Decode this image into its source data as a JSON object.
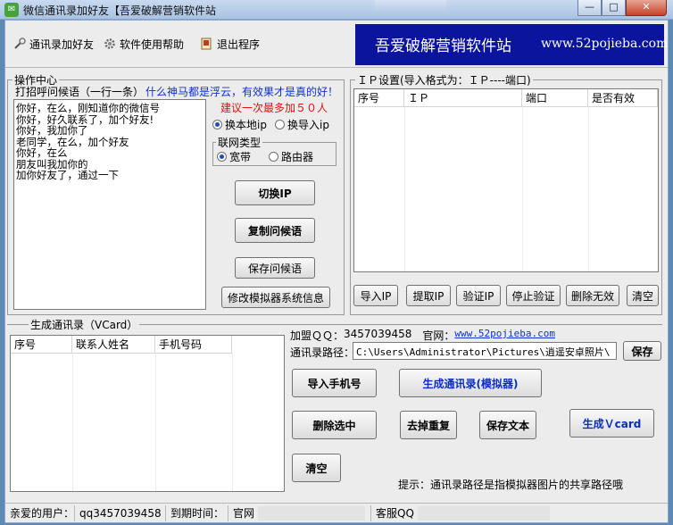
{
  "window": {
    "title": "微信通讯录加好友【吾爱破解营销软件站",
    "minimize": "—",
    "maximize": "□",
    "close": "✕"
  },
  "toolbar": {
    "items": [
      {
        "label": "通讯录加好友",
        "icon": "tools-icon"
      },
      {
        "label": "软件使用帮助",
        "icon": "gear-icon"
      },
      {
        "label": "退出程序",
        "icon": "exit-icon"
      }
    ]
  },
  "banner": {
    "left_text": "吾爱破解营销软件站",
    "right_text": "www.52pojieba.com"
  },
  "operation": {
    "legend": "操作中心",
    "greeting_label": "打招呼问候语（一行一条）",
    "slogan": "什么神马都是浮云，有效果才是真的好！",
    "greetings": [
      "你好，在么，刚知道你的微信号",
      "你好，好久联系了，加个好友!",
      "你好，我加你了",
      "老同学，在么，加个好友",
      "你好，在么",
      "朋友叫我加你的",
      "加你好友了，通过一下"
    ],
    "tip": "建议一次最多加５０人",
    "ip_mode": {
      "options": [
        "换本地ip",
        "换导入ip"
      ],
      "selected": 0
    },
    "net_type": {
      "legend": "联网类型",
      "options": [
        "宽带",
        "路由器"
      ],
      "selected": 0
    },
    "buttons": {
      "switch_ip": "切换IP",
      "copy_greeting": "复制问候语",
      "save_greeting": "保存问候语",
      "modify_emulator": "修改模拟器系统信息"
    }
  },
  "ip_settings": {
    "legend": "ＩＰ设置(导入格式为：ＩＰ----端口)",
    "columns": [
      "序号",
      "ＩＰ",
      "端口",
      "是否有效"
    ],
    "rows": [],
    "buttons": {
      "import": "导入IP",
      "fetch": "提取IP",
      "verify": "验证IP",
      "stop": "停止验证",
      "delete_invalid": "删除无效",
      "clear": "清空"
    }
  },
  "vcard": {
    "legend": "生成通讯录（VCard）",
    "columns": [
      "序号",
      "联系人姓名",
      "手机号码"
    ],
    "rows": [],
    "join_qq_label": "加盟ＱＱ：",
    "join_qq": "3457039458",
    "site_label": "官网：",
    "site_url": "www.52pojieba.com",
    "path_label": "通讯录路径：",
    "path_value": "C:\\Users\\Administrator\\Pictures\\逍遥安卓照片\\",
    "buttons": {
      "save": "保存",
      "import_phone": "导入手机号",
      "gen_emulator": "生成通讯录(模拟器)",
      "delete_selected": "删除选中",
      "dedupe": "去掉重复",
      "save_text": "保存文本",
      "gen_vcard": "生成Ｖcard",
      "clear": "清空"
    },
    "hint": "提示：通讯录路径是指模拟器图片的共享路径哦"
  },
  "status": {
    "user_label": "亲爱的用户：",
    "user_qq": "qq3457039458",
    "expire_label": "到期时间：",
    "site_label": "官网",
    "service_label": "客服QQ"
  }
}
